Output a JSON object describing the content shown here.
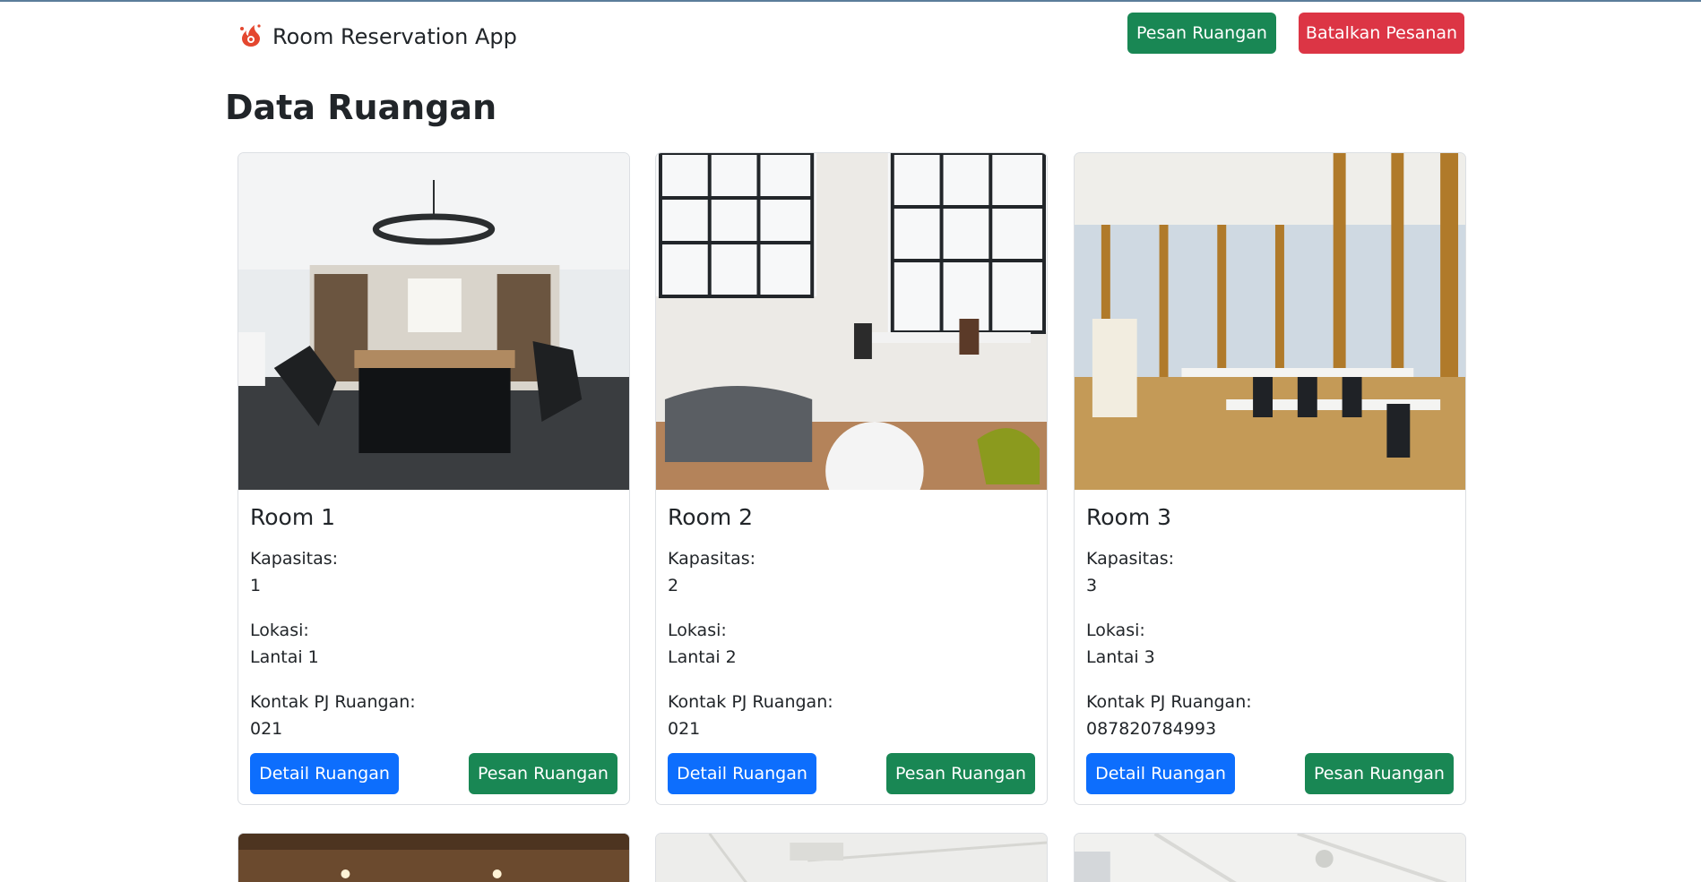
{
  "app": {
    "title": "Room Reservation App",
    "logo_icon": "flame-logo-icon"
  },
  "header": {
    "pesan_label": "Pesan Ruangan",
    "batalkan_label": "Batalkan Pesanan"
  },
  "colors": {
    "success": "#198754",
    "danger": "#dc3545",
    "primary": "#0d6efd"
  },
  "main": {
    "title": "Data Ruangan"
  },
  "rooms": [
    {
      "name": "Room 1",
      "kapasitas_label": "Kapasitas:",
      "kapasitas": "1",
      "lokasi_label": "Lokasi:",
      "lokasi": "Lantai 1",
      "kontak_label": "Kontak PJ Ruangan:",
      "kontak": "021",
      "detail_label": "Detail Ruangan",
      "pesan_label": "Pesan Ruangan"
    },
    {
      "name": "Room 2",
      "kapasitas_label": "Kapasitas:",
      "kapasitas": "2",
      "lokasi_label": "Lokasi:",
      "lokasi": "Lantai 2",
      "kontak_label": "Kontak PJ Ruangan:",
      "kontak": "021",
      "detail_label": "Detail Ruangan",
      "pesan_label": "Pesan Ruangan"
    },
    {
      "name": "Room 3",
      "kapasitas_label": "Kapasitas:",
      "kapasitas": "3",
      "lokasi_label": "Lokasi:",
      "lokasi": "Lantai 3",
      "kontak_label": "Kontak PJ Ruangan:",
      "kontak": "087820784993",
      "detail_label": "Detail Ruangan",
      "pesan_label": "Pesan Ruangan"
    }
  ]
}
